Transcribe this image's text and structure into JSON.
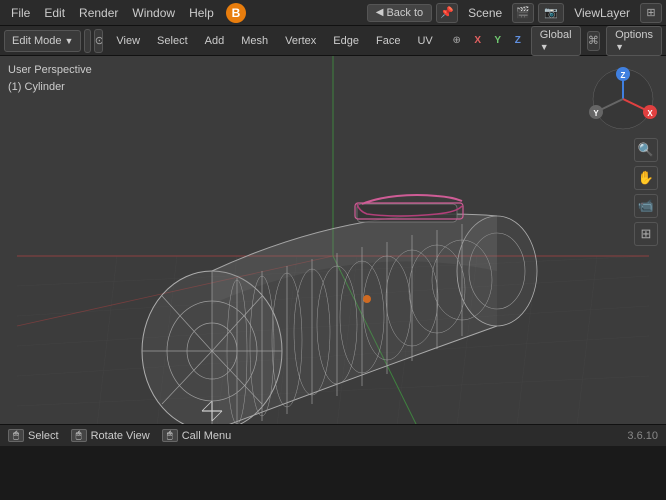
{
  "top_menu": {
    "items": [
      "File",
      "Edit",
      "Render",
      "Window",
      "Help"
    ],
    "back_label": "Back to",
    "scene_label": "Scene",
    "viewlayer_label": "ViewLayer"
  },
  "toolbar": {
    "mode_label": "Edit Mode",
    "view_label": "View",
    "select_label": "Select",
    "add_label": "Add",
    "mesh_label": "Mesh",
    "vertex_label": "Vertex",
    "edge_label": "Edge",
    "face_label": "Face",
    "uv_label": "UV",
    "xyz": [
      "X",
      "Y",
      "Z"
    ],
    "global_label": "Global",
    "options_label": "Options"
  },
  "viewport": {
    "perspective_label": "User Perspective",
    "object_label": "(1) Cylinder"
  },
  "statusbar": {
    "select_label": "Select",
    "rotate_label": "Rotate View",
    "menu_label": "Call Menu",
    "version": "3.6.10"
  }
}
